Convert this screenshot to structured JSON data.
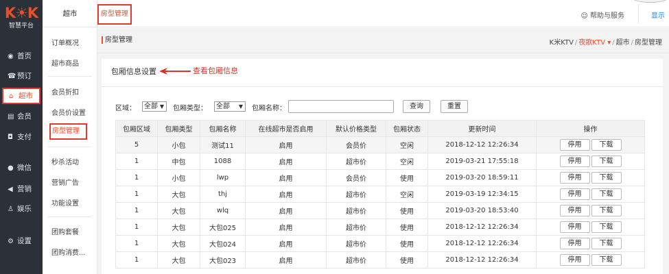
{
  "logo": {
    "mark": "K☀K",
    "subtitle": "智慧平台"
  },
  "left_nav": [
    {
      "icon": "dashboard-icon",
      "glyph": "◉",
      "label": "首页"
    },
    {
      "icon": "booking-icon",
      "glyph": "☎",
      "label": "预订"
    },
    {
      "icon": "shop-icon",
      "glyph": "⌂",
      "label": "超市",
      "active": true
    },
    {
      "icon": "member-icon",
      "glyph": "▤",
      "label": "会员"
    },
    {
      "icon": "pay-icon",
      "glyph": "◘",
      "label": "支付"
    },
    {
      "icon": "wechat-icon",
      "glyph": "●",
      "label": "微信"
    },
    {
      "icon": "marketing-icon",
      "glyph": "◀",
      "label": "营销"
    },
    {
      "icon": "entertainment-icon",
      "glyph": "♙",
      "label": "娱乐"
    },
    {
      "icon": "settings-icon",
      "glyph": "⚙",
      "label": "设置"
    }
  ],
  "submenu": {
    "title": "超市",
    "items": [
      "订单概况",
      "超市商品",
      "会员折扣",
      "会员价设置",
      "房型管理",
      "秒杀活动",
      "营销广告",
      "功能设置",
      "团购套餐",
      "团购消费..."
    ],
    "active": "房型管理"
  },
  "topbar": {
    "tab": "房型管理",
    "help": "☺ 帮助与服务",
    "show": "显示"
  },
  "breadcrumb": {
    "title": "房型管理",
    "root": "K米KTV",
    "sep": "/",
    "store": "夜歌KTV ▾",
    "section": "超市",
    "page": "房型管理"
  },
  "card": {
    "title": "包厢信息设置",
    "annotation": "查看包厢信息"
  },
  "filters": {
    "area_label": "区域：",
    "area_value": "全部",
    "type_label": "包厢类型：",
    "type_value": "全部",
    "name_label": "包厢名称：",
    "name_value": "",
    "search_button": "查询",
    "reset_button": "重置"
  },
  "table": {
    "columns": [
      "包厢区域",
      "包厢类型",
      "包厢名称",
      "在线超市是否启用",
      "默认价格类型",
      "包厢状态",
      "更新时间",
      "操作"
    ],
    "action_disable": "停用",
    "action_download": "下载",
    "rows": [
      [
        "5",
        "小包",
        "测试11",
        "启用",
        "会员价",
        "空闲",
        "2018-12-12 12:26:34"
      ],
      [
        "1",
        "中包",
        "1088",
        "启用",
        "超市价",
        "空闲",
        "2019-03-21 17:55:18"
      ],
      [
        "1",
        "小包",
        "lwp",
        "启用",
        "会员价",
        "使用",
        "2019-03-20 18:59:11"
      ],
      [
        "1",
        "大包",
        "thj",
        "启用",
        "超市价",
        "空闲",
        "2019-03-19 12:34:15"
      ],
      [
        "1",
        "大包",
        "wlq",
        "启用",
        "超市价",
        "使用",
        "2019-03-20 18:53:40"
      ],
      [
        "1",
        "大包",
        "大包025",
        "启用",
        "超市价",
        "使用",
        "2018-12-12 12:26:34"
      ],
      [
        "1",
        "大包",
        "大包024",
        "启用",
        "超市价",
        "使用",
        "2018-12-12 12:26:34"
      ],
      [
        "1",
        "大包",
        "大包023",
        "启用",
        "超市价",
        "使用",
        "2018-12-12 12:26:34"
      ]
    ]
  },
  "colors": {
    "accent": "#e8502b",
    "highlight_border": "#e03a2f",
    "sidebar_bg": "#2c3038",
    "link": "#2a7ad8"
  }
}
